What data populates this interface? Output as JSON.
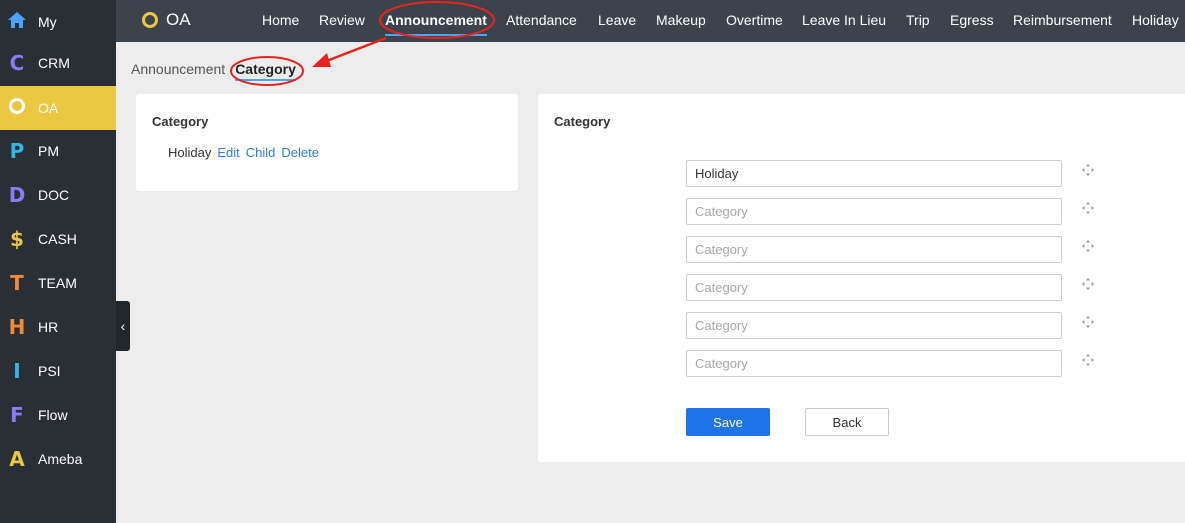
{
  "sidebar": {
    "items": [
      {
        "icon": "home-icon",
        "glyph": "",
        "label": "My",
        "color": "#4aa3ff"
      },
      {
        "icon": "crm-letter-icon",
        "glyph": "C",
        "label": "CRM",
        "color": "#8b7cf6"
      },
      {
        "icon": "oa-ring-icon",
        "glyph": "",
        "label": "OA",
        "color": "#ffffff"
      },
      {
        "icon": "pm-letter-icon",
        "glyph": "P",
        "label": "PM",
        "color": "#35b7e6"
      },
      {
        "icon": "doc-letter-icon",
        "glyph": "D",
        "label": "DOC",
        "color": "#8b7cf6"
      },
      {
        "icon": "cash-dollar-icon",
        "glyph": "$",
        "label": "CASH",
        "color": "#eac842"
      },
      {
        "icon": "team-letter-icon",
        "glyph": "T",
        "label": "TEAM",
        "color": "#f08a3c"
      },
      {
        "icon": "hr-letter-icon",
        "glyph": "H",
        "label": "HR",
        "color": "#f08a3c"
      },
      {
        "icon": "psi-letter-icon",
        "glyph": "I",
        "label": "PSI",
        "color": "#35b7e6"
      },
      {
        "icon": "flow-letter-icon",
        "glyph": "F",
        "label": "Flow",
        "color": "#8b7cf6"
      },
      {
        "icon": "ameba-letter-icon",
        "glyph": "A",
        "label": "Ameba",
        "color": "#eac842"
      }
    ],
    "active_index": 2,
    "active_color": "#eac842",
    "collapse_glyph": "‹"
  },
  "topbar": {
    "brand": "OA",
    "brand_color": "#eac842",
    "nav": [
      "Home",
      "Review",
      "Announcement",
      "Attendance",
      "Leave",
      "Makeup",
      "Overtime",
      "Leave In Lieu",
      "Trip",
      "Egress",
      "Reimbursement",
      "Holiday"
    ],
    "active_nav": "Announcement"
  },
  "breadcrumb": {
    "parent": "Announcement",
    "current": "Category"
  },
  "left_panel": {
    "title": "Category",
    "tree": [
      {
        "name": "Holiday",
        "actions": [
          "Edit",
          "Child",
          "Delete"
        ]
      }
    ]
  },
  "form": {
    "title": "Category",
    "fields": [
      {
        "value": "Holiday",
        "placeholder": "Category"
      },
      {
        "value": "",
        "placeholder": "Category"
      },
      {
        "value": "",
        "placeholder": "Category"
      },
      {
        "value": "",
        "placeholder": "Category"
      },
      {
        "value": "",
        "placeholder": "Category"
      },
      {
        "value": "",
        "placeholder": "Category"
      }
    ],
    "save_label": "Save",
    "back_label": "Back",
    "primary_color": "#1e73e8"
  },
  "annotation_color": "#e8231f"
}
